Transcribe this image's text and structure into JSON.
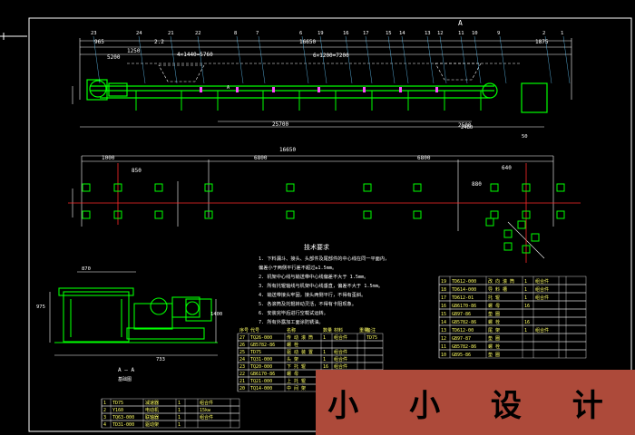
{
  "colors": {
    "background": "#000000",
    "frame": "#ffffff",
    "conveyor": "#00ff00",
    "dimension": "#ffffff",
    "centerline": "#ff2a2a",
    "table_text": "#ffff66",
    "leader": "#66ccff",
    "watermark_bg": "#ad4a3a"
  },
  "watermark": "小 小 设 计",
  "section_label": "A — A",
  "view_label": "A",
  "notes_title": "技术要求",
  "notes": [
    "1. 下料漏斗、接头、头部件及尾部件的中心线在同一平面内，",
    "   偏差小于两侧平行差不超过±1.5mm。",
    "2. 机架中心线与输送带中心线偏差不大于 1.5mm。",
    "3. 所有托辊轴线与机架中心线垂直，偏差不大于 1.5mm。",
    "4. 输送带接头牢固，接头两侧平行，不得有歪斜。",
    "5. 各滚筒及托辊转动灵活，不得有卡阻现象。",
    "6. 安装完毕后进行空载试运转。",
    "7. 所有外露加工面涂防锈油。"
  ],
  "top_dims": [
    "965",
    "1250",
    "2.2",
    "5200",
    "4×1440=5760",
    "16650",
    "6×1200=7200",
    "2500",
    "1875"
  ],
  "plan_dims": [
    "16650",
    "1000",
    "850",
    "6800",
    "6800",
    "640",
    "880"
  ],
  "bottom_dims": [
    "25700"
  ],
  "part_numbers": [
    "23",
    "24",
    "21",
    "22",
    "8",
    "7",
    "6",
    "19",
    "16",
    "17",
    "15",
    "14",
    "13",
    "12",
    "11",
    "10",
    "9",
    "2",
    "1"
  ],
  "small_labels": [
    "870",
    "975",
    "1400",
    "733",
    "2480",
    "50"
  ],
  "table_left": {
    "headers": [
      "序号",
      "代号",
      "名称",
      "数量",
      "材料",
      "重量",
      "备注"
    ],
    "rows": [
      [
        "27",
        "TQ26-000",
        "传 动 滚 筒",
        "1",
        "组合件",
        "",
        "TD75"
      ],
      [
        "26",
        "GB5782-86",
        "螺 栓",
        "",
        "",
        "",
        ""
      ],
      [
        "25",
        "TD75",
        "驱 动 装 置",
        "1",
        "组合件",
        "",
        ""
      ],
      [
        "24",
        "TQ31-000",
        "头 架",
        "1",
        "组合件",
        "",
        ""
      ],
      [
        "23",
        "TQ20-000",
        "下 托 辊",
        "16",
        "组合件",
        "",
        ""
      ],
      [
        "22",
        "GB6170-86",
        "螺 母",
        "",
        "",
        "",
        ""
      ],
      [
        "21",
        "TQ21-000",
        "上 托 辊",
        "1",
        "组合件",
        "",
        ""
      ],
      [
        "20",
        "TQ14-000",
        "中 间 架",
        "1",
        "组合件",
        "",
        ""
      ]
    ]
  },
  "table_right": {
    "rows": [
      [
        "19",
        "TD612-000",
        "改 向 滚 筒",
        "1",
        "组合件",
        "",
        ""
      ],
      [
        "18",
        "TD614-000",
        "导 料 槽",
        "1",
        "组合件",
        "",
        ""
      ],
      [
        "17",
        "TD612-01",
        "托 辊",
        "1",
        "组合件",
        "",
        ""
      ],
      [
        "16",
        "GB6170-86",
        "螺 母",
        "16",
        "",
        "",
        ""
      ],
      [
        "15",
        "GB97-86",
        "垫 圈",
        "",
        "",
        "",
        ""
      ],
      [
        "14",
        "GB5782-86",
        "螺 栓",
        "16",
        "",
        "",
        ""
      ],
      [
        "13",
        "TD612-00",
        "尾 架",
        "1",
        "组合件",
        "",
        ""
      ],
      [
        "12",
        "GB97-87",
        "垫 圈",
        "",
        "",
        "",
        ""
      ],
      [
        "11",
        "GB5782-86",
        "螺 栓",
        "",
        "",
        "",
        ""
      ],
      [
        "10",
        "GB95-86",
        "垫 圈",
        "",
        "",
        "",
        ""
      ]
    ]
  },
  "title_block": {
    "rows": [
      [
        "1",
        "TD75",
        "减速器",
        "1",
        "",
        "组合件",
        ""
      ],
      [
        "2",
        "Y160",
        "电动机",
        "1",
        "",
        "15kw",
        ""
      ],
      [
        "3",
        "TQ63-000",
        "联轴器",
        "1",
        "",
        "组合件",
        ""
      ],
      [
        "4",
        "TD31-000",
        "驱动架",
        "1",
        "",
        "",
        ""
      ]
    ],
    "cells": [
      "500mm",
      "TD75",
      "1",
      "1",
      "组合件"
    ]
  }
}
